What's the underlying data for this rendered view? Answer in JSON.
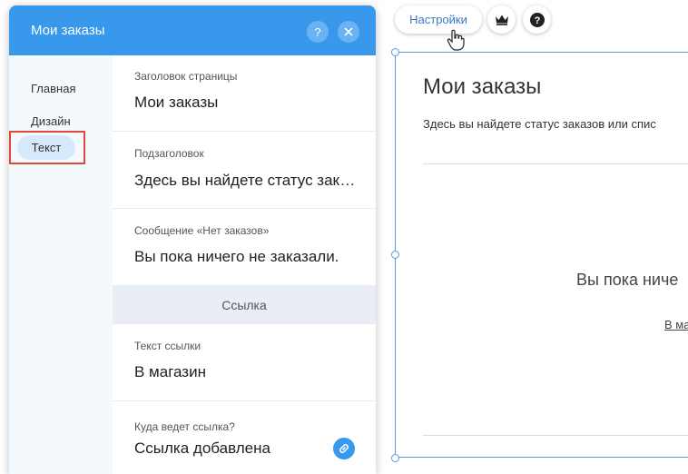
{
  "panel": {
    "title": "Мои заказы",
    "help_icon": "question-icon",
    "close_icon": "close-icon",
    "nav": [
      {
        "label": "Главная"
      },
      {
        "label": "Дизайн"
      },
      {
        "label": "Текст",
        "active": true
      }
    ],
    "fields": {
      "page_title_label": "Заголовок страницы",
      "page_title_value": "Мои заказы",
      "subtitle_label": "Подзаголовок",
      "subtitle_value": "Здесь вы найдете статус заказов или список",
      "no_orders_label": "Сообщение «Нет заказов»",
      "no_orders_value": "Вы пока ничего не заказали.",
      "link_section": "Ссылка",
      "link_text_label": "Текст ссылки",
      "link_text_value": "В магазин",
      "link_target_label": "Куда ведет ссылка?",
      "link_target_value": "Ссылка добавлена"
    },
    "accent_color": "#3899ec",
    "highlight_color": "#e0483b"
  },
  "toolbar": {
    "settings_label": "Настройки",
    "crown_icon": "crown-icon",
    "help_icon": "question-icon"
  },
  "canvas": {
    "title": "Мои заказы",
    "subtitle": "Здесь вы найдете статус заказов или спис",
    "empty_message": "Вы пока ниче",
    "link": "В ма"
  }
}
